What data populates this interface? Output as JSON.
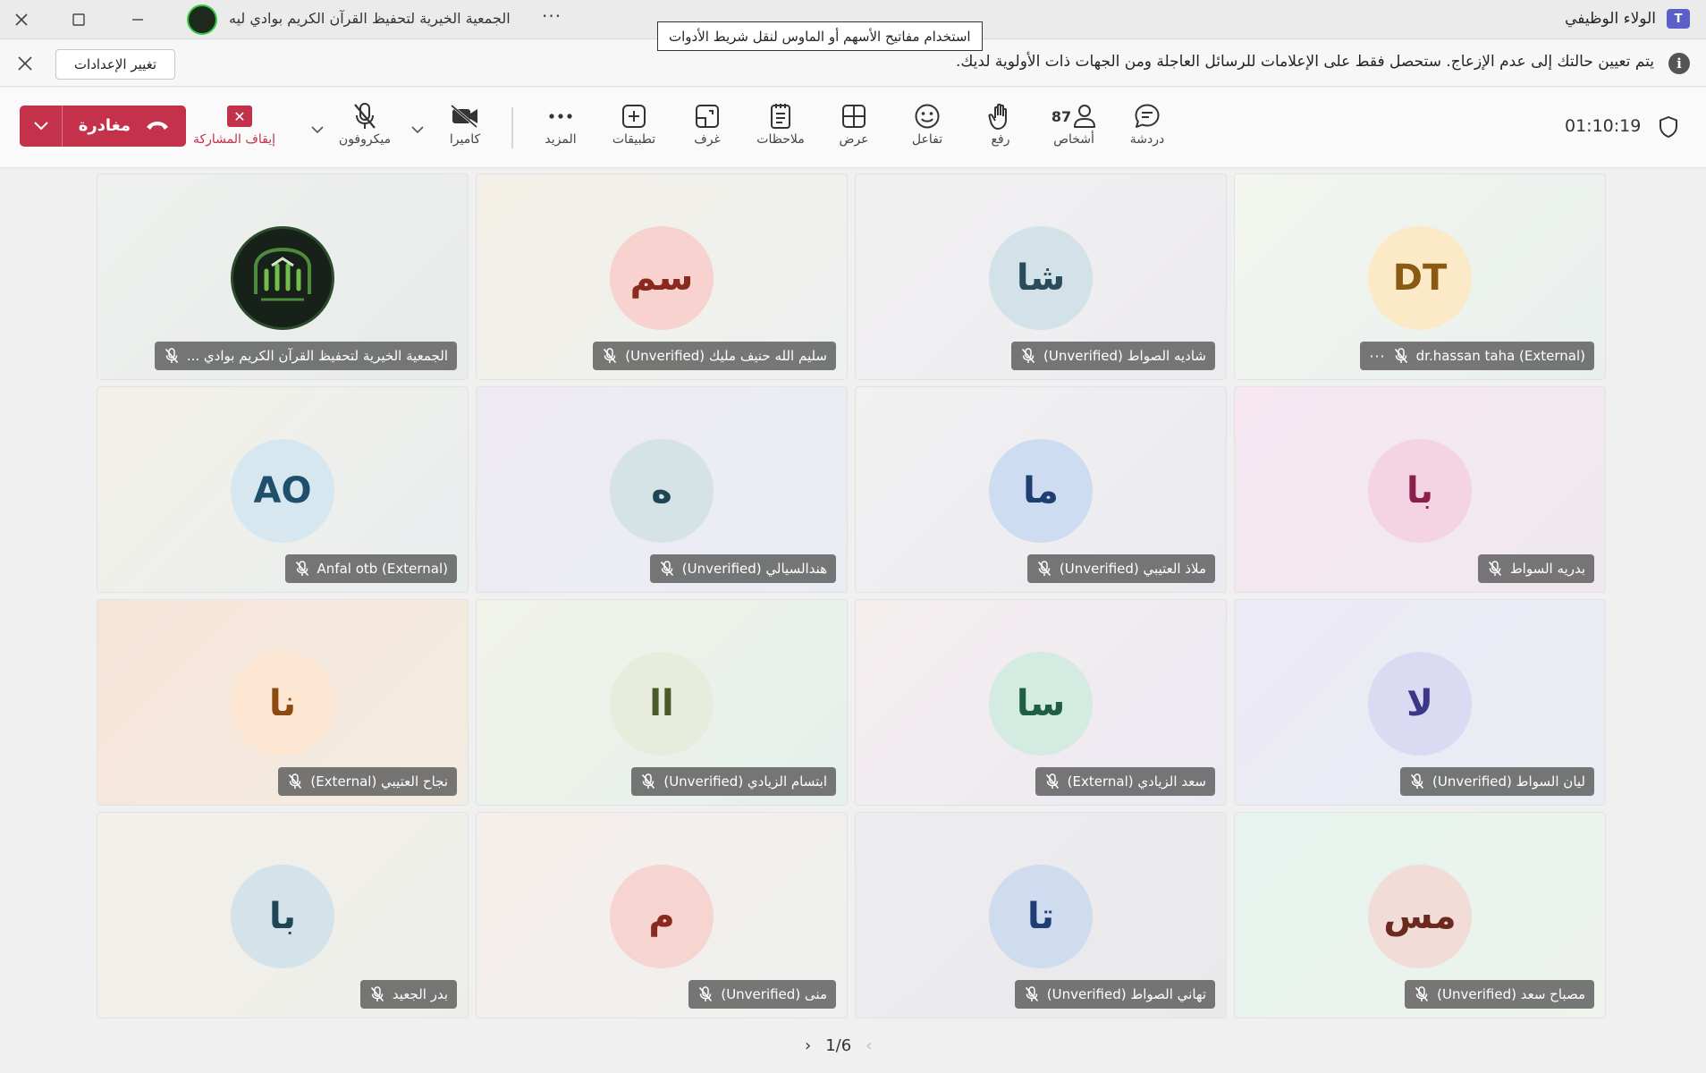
{
  "titlebar": {
    "app_name": "الولاء الوظيفي",
    "app_icon_text": "T",
    "meeting_title": "الجمعية الخيرية لتحفيظ القرآن الكريم بوادي ليه",
    "more": "···"
  },
  "tooltip": "استخدام مفاتيح الأسهم أو الماوس لنقل شريط الأدوات",
  "notice": {
    "text": "يتم تعيين حالتك إلى عدم الإزعاج. ستحصل فقط على الإعلامات للرسائل العاجلة ومن الجهات ذات الأولوية لديك.",
    "settings_button": "تغيير الإعدادات",
    "info_icon": "i"
  },
  "toolbar": {
    "leave_label": "مغادرة",
    "stop_sharing_label": "إيقاف المشاركة",
    "mic_label": "ميكروفون",
    "camera_label": "كاميرا",
    "more_label": "المزيد",
    "apps_label": "تطبيقات",
    "rooms_label": "غرف",
    "notes_label": "ملاحظات",
    "view_label": "عرض",
    "react_label": "تفاعل",
    "raise_label": "رفع",
    "people_label": "أشخاص",
    "people_count": "87",
    "chat_label": "دردشة",
    "timer": "01:10:19"
  },
  "participants": [
    {
      "initials": "DT",
      "name": "dr.hassan taha (External)",
      "bg": "#fbe9c8",
      "fg": "#8a5a12",
      "has_more": true
    },
    {
      "initials": "شا",
      "name": "شاديه الصواط (Unverified)",
      "bg": "#d3e2e9",
      "fg": "#2b4b5c",
      "has_more": false
    },
    {
      "initials": "سم",
      "name": "سليم الله حنيف مليك (Unverified)",
      "bg": "#f7d2cf",
      "fg": "#8a2a1f",
      "has_more": false
    },
    {
      "initials": "",
      "name": "الجمعية الخيرية لتحفيظ القرآن الكريم بوادي ...",
      "bg": "#17211a",
      "fg": "#ffffff",
      "has_more": false,
      "is_logo": true
    },
    {
      "initials": "با",
      "name": "بدريه السواط",
      "bg": "#f4d3e2",
      "fg": "#8a1f4b",
      "has_more": false
    },
    {
      "initials": "ما",
      "name": "ملاذ العتيبي (Unverified)",
      "bg": "#cddcf0",
      "fg": "#1f3f73",
      "has_more": false
    },
    {
      "initials": "ه",
      "name": "هندالسيالي (Unverified)",
      "bg": "#d5e3e7",
      "fg": "#1f4655",
      "has_more": false
    },
    {
      "initials": "AO",
      "name": "Anfal otb (External)",
      "bg": "#d7e7f0",
      "fg": "#1f4f6b",
      "has_more": false
    },
    {
      "initials": "لا",
      "name": "ليان السواط (Unverified)",
      "bg": "#dcdaf2",
      "fg": "#3c3787",
      "has_more": false
    },
    {
      "initials": "سا",
      "name": "سعد الزيادي (External)",
      "bg": "#d3ebe1",
      "fg": "#1f5e45",
      "has_more": false
    },
    {
      "initials": "اا",
      "name": "ابتسام الزيادي (Unverified)",
      "bg": "#e8ecdc",
      "fg": "#4b5a2b",
      "has_more": false
    },
    {
      "initials": "نا",
      "name": "نجاح العتيبي (External)",
      "bg": "#fde7d2",
      "fg": "#8a4a12",
      "has_more": false
    },
    {
      "initials": "مس",
      "name": "مصباح سعد (Unverified)",
      "bg": "#f2dcd8",
      "fg": "#6b2a1f",
      "has_more": false
    },
    {
      "initials": "تا",
      "name": "تهاني الصواط (Unverified)",
      "bg": "#cfdcef",
      "fg": "#1f3f73",
      "has_more": false
    },
    {
      "initials": "م",
      "name": "منى (Unverified)",
      "bg": "#f6d4d0",
      "fg": "#8a2a1f",
      "has_more": false
    },
    {
      "initials": "با",
      "name": "بدر الجعيد",
      "bg": "#d4e2ea",
      "fg": "#1f4655",
      "has_more": false
    }
  ],
  "pager": {
    "text": "1/6",
    "prev": "‹",
    "next": "›"
  }
}
